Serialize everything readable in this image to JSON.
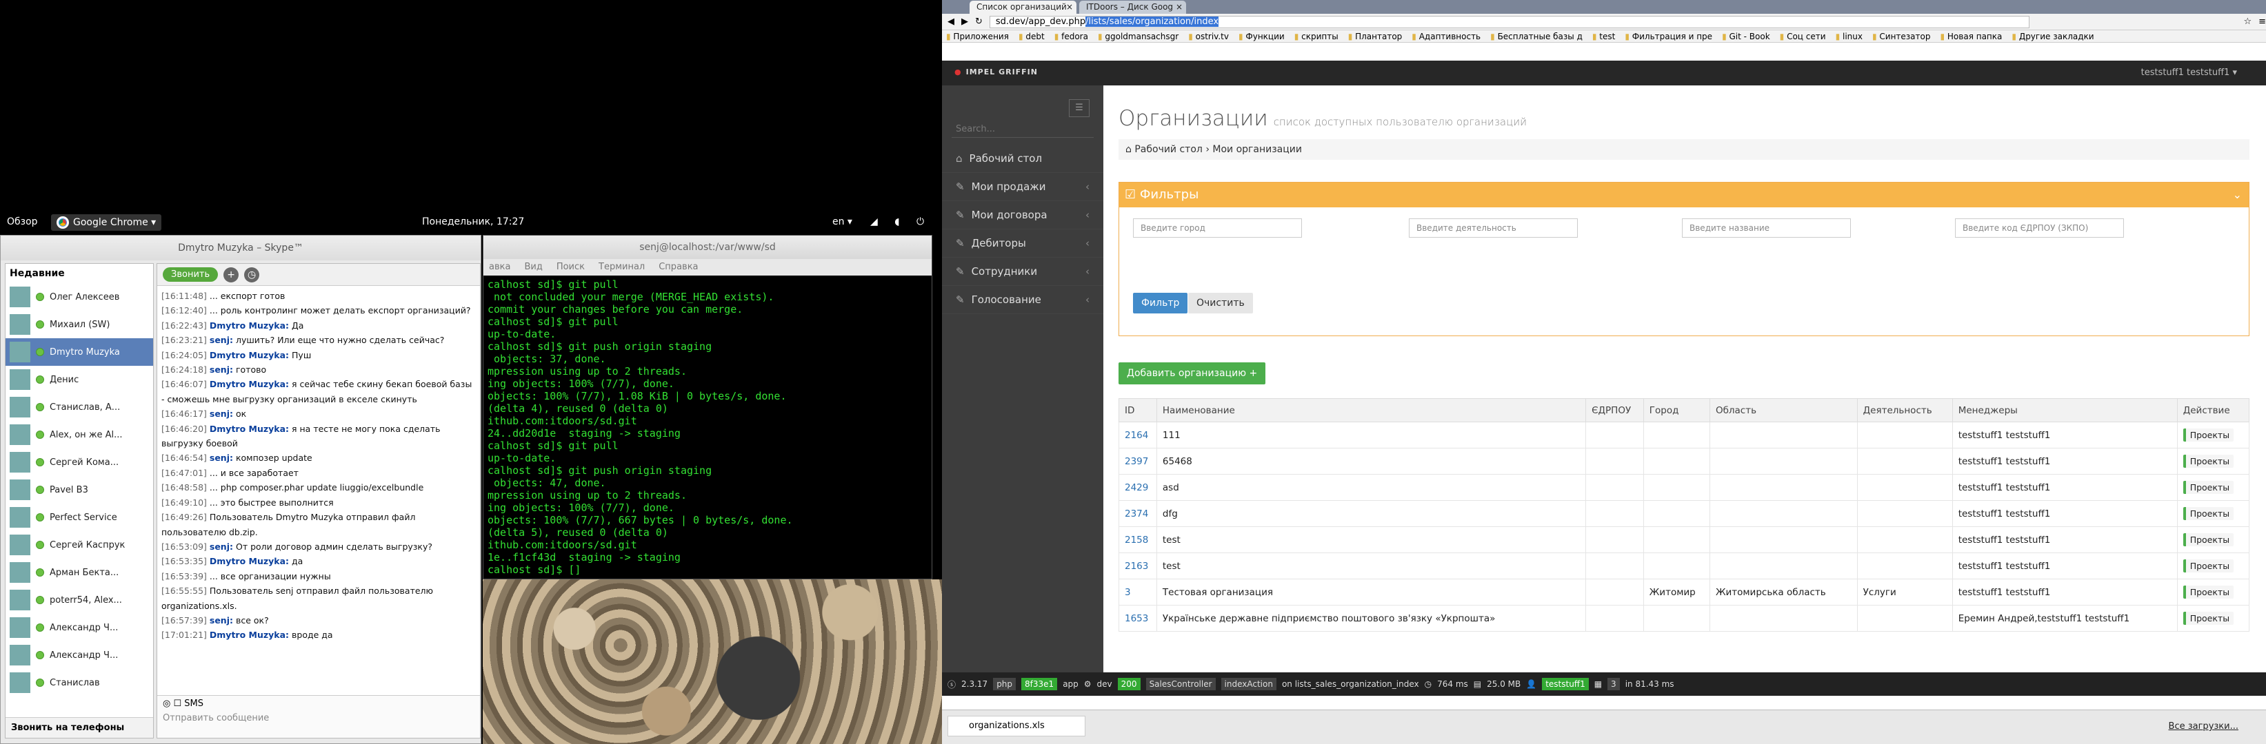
{
  "gnome": {
    "overview": "Обзор",
    "app": "Google Chrome ▾",
    "clock": "Понедельник, 17:27",
    "lang": "en ▾"
  },
  "skype": {
    "title": "Dmytro Muzyka – Skype™",
    "recent": "Недавние",
    "call": "Звонить",
    "call_phones": "Звонить на телефоны",
    "sms": "SMS",
    "input_placeholder": "Отправить сообщение",
    "contacts": [
      "Олег Алексеев",
      "Михаил (SW)",
      "Dmytro Muzyka",
      "Денис",
      "Станислав, А...",
      "Alex, он же Al...",
      "Сергей  Кома...",
      "Pavel B3",
      "Perfect Service",
      "Сергей Каспрук",
      "Арман Бекта...",
      "poterr54, Alex...",
      "Александр Ч...",
      "Александр Ч...",
      "Станислав"
    ],
    "messages": [
      [
        "[16:11:48]",
        "",
        "... експорт готов"
      ],
      [
        "[16:12:40]",
        "",
        "... роль контролинг может делать експорт организаций?"
      ],
      [
        "[16:22:43]",
        "Dmytro Muzyka:",
        "Да"
      ],
      [
        "[16:23:21]",
        "senj:",
        "лушить? Или еще что нужно сделать сейчас?"
      ],
      [
        "[16:24:05]",
        "Dmytro Muzyka:",
        "Пуш"
      ],
      [
        "[16:24:18]",
        "senj:",
        "готово"
      ],
      [
        "[16:46:07]",
        "Dmytro Muzyka:",
        "я сейчас тебе скину бекап боевой базы - сможешь мне выгрузку организаций в екселе скинуть"
      ],
      [
        "[16:46:17]",
        "senj:",
        "ок"
      ],
      [
        "[16:46:20]",
        "Dmytro Muzyka:",
        "я на тесте не могу пока сделать выгрузку боевой"
      ],
      [
        "[16:46:54]",
        "senj:",
        "композер update"
      ],
      [
        "[16:47:01]",
        "",
        "... и все заработает"
      ],
      [
        "[16:48:58]",
        "",
        "...   php composer.phar update liuggio/excelbundle"
      ],
      [
        "[16:49:10]",
        "",
        "... это быстрее выполнится"
      ],
      [
        "[16:49:26]",
        "",
        "Пользователь Dmytro Muzyka отправил файл пользователю db.zip."
      ],
      [
        "[16:53:09]",
        "senj:",
        "От роли договор админ сделать выгрузку?"
      ],
      [
        "[16:53:35]",
        "Dmytro Muzyka:",
        "да"
      ],
      [
        "[16:53:39]",
        "",
        "... все организации нужны"
      ],
      [
        "[16:55:55]",
        "",
        "Пользователь senj отправил файл пользователю organizations.xls."
      ],
      [
        "[16:57:39]",
        "senj:",
        "все ок?"
      ],
      [
        "[17:01:21]",
        "Dmytro Muzyka:",
        "вроде да"
      ]
    ]
  },
  "terminal": {
    "title": "senj@localhost:/var/www/sd",
    "menu": [
      "авка",
      "Вид",
      "Поиск",
      "Терминал",
      "Справка"
    ],
    "lines": [
      "calhost sd]$ git pull",
      " not concluded your merge (MERGE_HEAD exists).",
      "commit your changes before you can merge.",
      "calhost sd]$ git pull",
      "up-to-date.",
      "calhost sd]$ git push origin staging",
      " objects: 37, done.",
      "mpression using up to 2 threads.",
      "ing objects: 100% (7/7), done.",
      "objects: 100% (7/7), 1.08 KiB | 0 bytes/s, done.",
      "(delta 4), reused 0 (delta 0)",
      "ithub.com:itdoors/sd.git",
      "24..dd20d1e  staging -> staging",
      "calhost sd]$ git pull",
      "up-to-date.",
      "calhost sd]$ git push origin staging",
      " objects: 47, done.",
      "mpression using up to 2 threads.",
      "ing objects: 100% (7/7), done.",
      "objects: 100% (7/7), 667 bytes | 0 bytes/s, done.",
      "(delta 5), reused 0 (delta 0)",
      "ithub.com:itdoors/sd.git",
      "1e..f1cf43d  staging -> staging",
      "calhost sd]$ []"
    ]
  },
  "browser": {
    "tabs": [
      "Список организаций",
      "ITDoors – Диск Goog"
    ],
    "url_prefix": "sd.dev/app_dev.php",
    "url_selected": "/lists/sales/organization/index",
    "bookmarks": [
      "Приложения",
      "debt",
      "fedora",
      "ggoldmansachsgr",
      "ostriv.tv",
      "Функции",
      "скрипты",
      "Плантатор",
      "Адаптивность",
      "Бесплатные базы д",
      "test",
      "Фильтрация и пре",
      "Git - Book",
      "Соц сети",
      "linux",
      "Синтезатор",
      "Новая папка",
      "Другие закладки"
    ]
  },
  "app": {
    "brand": "IMPEL GRIFFIN",
    "user": "teststuff1 teststuff1 ▾",
    "search_placeholder": "Search...",
    "nav": [
      "Рабочий стол",
      "Мои продажи",
      "Мои договора",
      "Дебиторы",
      "Сотрудники",
      "Голосование"
    ],
    "title": "Организации",
    "subtitle": "список доступных пользователю организаций",
    "crumb": [
      "Рабочий стол",
      "Мои организации"
    ],
    "filters": {
      "title": "Фильтры",
      "city": "Введите город",
      "activity": "Введите деятельность",
      "name": "Введите название",
      "edrpou": "Введите код ЄДРПОУ (ЗКПО)",
      "apply": "Фильтр",
      "clear": "Очистить"
    },
    "add_button": "Добавить организацию +",
    "columns": [
      "ID",
      "Наименование",
      "ЄДРПОУ",
      "Город",
      "Область",
      "Деятельность",
      "Менеджеры",
      "Действие"
    ],
    "rows": [
      [
        "2164",
        "111",
        "",
        "",
        "",
        "",
        "teststuff1 teststuff1",
        "Проекты"
      ],
      [
        "2397",
        "65468",
        "",
        "",
        "",
        "",
        "teststuff1 teststuff1",
        "Проекты"
      ],
      [
        "2429",
        "asd",
        "",
        "",
        "",
        "",
        "teststuff1 teststuff1",
        "Проекты"
      ],
      [
        "2374",
        "dfg",
        "",
        "",
        "",
        "",
        "teststuff1 teststuff1",
        "Проекты"
      ],
      [
        "2158",
        "test",
        "",
        "",
        "",
        "",
        "teststuff1 teststuff1",
        "Проекты"
      ],
      [
        "2163",
        "test",
        "",
        "",
        "",
        "",
        "teststuff1 teststuff1",
        "Проекты"
      ],
      [
        "3",
        "Тестовая организация",
        "",
        "Житомир",
        "Житомирська область",
        "Услуги",
        "teststuff1 teststuff1",
        "Проекты"
      ],
      [
        "1653",
        "Українське державне підприємство поштового зв'язку «Укрпошта»",
        "",
        "",
        "",
        "",
        "Еремин Андрей,teststuff1 teststuff1",
        "Проекты"
      ]
    ]
  },
  "symfony": {
    "version": "2.3.17",
    "hash": "8f33e1",
    "app": "app",
    "env": "dev",
    "status": "200",
    "controller": "SalesController",
    "action": "indexAction",
    "route": "on lists_sales_organization_index",
    "time": "764 ms",
    "mem": "25.0 MB",
    "user": "teststuff1",
    "queries": "3",
    "qtime": "in 81.43 ms"
  },
  "downloads": {
    "file": "organizations.xls",
    "all": "Все загрузки..."
  }
}
